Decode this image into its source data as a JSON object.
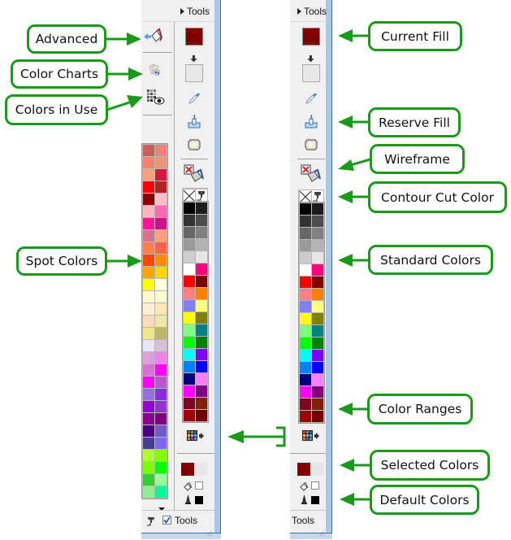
{
  "colors": {
    "callout_border": "#1a9a1a",
    "arrow": "#1a9a1a",
    "panel_bg": "#f0f0f0",
    "window_frame": "#a9c8e8"
  },
  "left_panel": {
    "header_label": "Tools",
    "footer_label": "Tools",
    "footer_checkbox_checked": true,
    "current_fill_color": "#800000",
    "reserve_fill_color": "#e8e8e8",
    "selected_colors": [
      "#800000",
      "#e6e6e6"
    ],
    "default_fill_color": "#ffffff",
    "default_outline_color": "#000000",
    "spot_colors": [
      "#cd5c5c",
      "#f08080",
      "#fa8072",
      "#e9967a",
      "#ffa07a",
      "#dc143c",
      "#ff0000",
      "#b22222",
      "#8b0000",
      "#ffc0cb",
      "#ffb6c1",
      "#ff69b4",
      "#ff1493",
      "#c71585",
      "#db7093",
      "#ffa07a",
      "#ff7f50",
      "#ff6347",
      "#ff4500",
      "#ff8c00",
      "#ffa500",
      "#ffd700",
      "#ffff00",
      "#ffffe0",
      "#fffacd",
      "#fafad2",
      "#ffefd5",
      "#ffe4b5",
      "#ffdab9",
      "#eee8aa",
      "#f0e68c",
      "#bdb76b",
      "#e6e6fa",
      "#d8bfd8",
      "#dda0dd",
      "#ee82ee",
      "#da70d6",
      "#ff00ff",
      "#ff00ff",
      "#ba55d3",
      "#9370db",
      "#8a2be2",
      "#9400d3",
      "#9932cc",
      "#8b008b",
      "#800080",
      "#4b0082",
      "#6a5acd",
      "#483d8b",
      "#7b68ee",
      "#adff2f",
      "#7fff00",
      "#7cfc00",
      "#00ff00",
      "#32cd32",
      "#98fb98",
      "#90ee90",
      "#00fa9a"
    ]
  },
  "right_panel": {
    "header_label": "Tools",
    "footer_label": "Tools",
    "current_fill_color": "#800000",
    "reserve_fill_color": "#e8e8e8",
    "selected_colors": [
      "#800000",
      "#e6e6e6"
    ],
    "default_fill_color": "#ffffff",
    "default_outline_color": "#000000",
    "standard_colors": [
      "#000000",
      "#1c1c1c",
      "#333333",
      "#4d4d4d",
      "#666666",
      "#808080",
      "#999999",
      "#b3b3b3",
      "#cccccc",
      "#e6e6e6",
      "#ffffff",
      "#ff0080",
      "#ff0000",
      "#800000",
      "#ff8080",
      "#ff8000",
      "#8080ff",
      "#ffff80",
      "#ffff00",
      "#808000",
      "#80ff80",
      "#008080",
      "#00ff00",
      "#008000",
      "#00ffff",
      "#8000ff",
      "#0080ff",
      "#0000ff",
      "#000080",
      "#ff80ff",
      "#ff00ff",
      "#800080",
      "#800020",
      "#802000",
      "#a00000",
      "#700000"
    ],
    "color_ranges_icon_colors": [
      "#ff3030",
      "#30c030",
      "#3050ff",
      "#ffd000",
      "#ff80ff",
      "#30d0d0",
      "#ff8000",
      "#8040ff",
      "#40a0ff"
    ]
  },
  "callouts": {
    "advanced": "Advanced",
    "color_charts": "Color Charts",
    "colors_in_use": "Colors in Use",
    "spot_colors": "Spot Colors",
    "current_fill": "Current Fill",
    "reserve_fill": "Reserve Fill",
    "wireframe": "Wireframe",
    "contour_cut_color": "Contour Cut Color",
    "standard_colors": "Standard Colors",
    "color_ranges": "Color Ranges",
    "selected_colors": "Selected Colors",
    "default_colors": "Default Colors"
  }
}
